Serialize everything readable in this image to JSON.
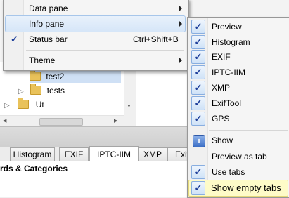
{
  "main_menu": {
    "items": [
      {
        "label": "Data pane",
        "checked": false,
        "submenu": true
      },
      {
        "label": "Info pane",
        "checked": false,
        "submenu": true,
        "highlighted": true
      },
      {
        "label": "Status bar",
        "checked": true,
        "shortcut": "Ctrl+Shift+B",
        "submenu": false
      },
      {
        "label": "Theme",
        "checked": false,
        "submenu": true
      }
    ]
  },
  "info_submenu": {
    "items": [
      {
        "label": "Preview",
        "checked": true
      },
      {
        "label": "Histogram",
        "checked": true
      },
      {
        "label": "EXIF",
        "checked": true
      },
      {
        "label": "IPTC-IIM",
        "checked": true
      },
      {
        "label": "XMP",
        "checked": true
      },
      {
        "label": "ExifTool",
        "checked": true
      },
      {
        "label": "GPS",
        "checked": true
      },
      {
        "label": "Show",
        "icon": "info-icon"
      },
      {
        "label": "Preview as tab",
        "checked": false
      },
      {
        "label": "Use tabs",
        "checked": true
      },
      {
        "label": "Show empty tabs",
        "checked": true,
        "highlighted": true
      }
    ]
  },
  "check_glyph": "✓",
  "tree": {
    "items": [
      {
        "label": "test2",
        "selected": true
      },
      {
        "label": "tests",
        "expandable": true
      },
      {
        "label": "Ut",
        "expandable": true
      }
    ],
    "scroll_up": "▲",
    "scroll_down": "▼",
    "scroll_left": "◀",
    "scroll_right": "▶"
  },
  "tabs": {
    "items": [
      "Histogram",
      "EXIF",
      "IPTC-IIM",
      "XMP",
      "Exif"
    ],
    "active": "IPTC-IIM"
  },
  "panel": {
    "heading": "rds & Categories"
  },
  "colors": {
    "highlight_blue": "#d6e6f8",
    "highlight_yellow": "#fefbc8",
    "check": "#1f3f9a"
  }
}
